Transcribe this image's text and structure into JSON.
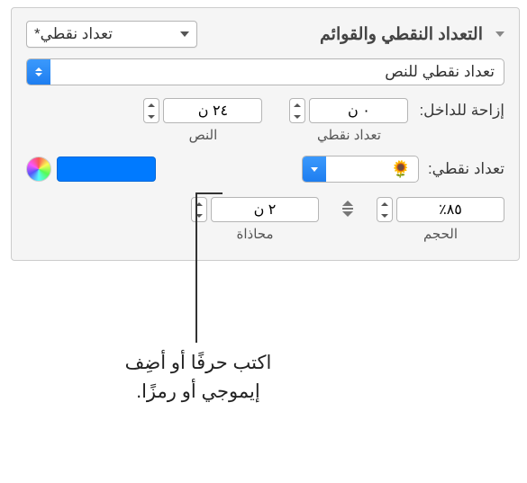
{
  "header": {
    "title": "التعداد النقطي والقوائم",
    "style_popup": "تعداد نقطي*"
  },
  "list_type": {
    "value": "تعداد نقطي للنص"
  },
  "indent": {
    "label": "إزاحة للداخل:",
    "bullet": {
      "value": "٠ ن",
      "caption": "تعداد نقطي"
    },
    "text": {
      "value": "٢٤ ن",
      "caption": "النص"
    }
  },
  "bullet": {
    "label": "تعداد نقطي:",
    "emoji": "🌻",
    "color": "#007aff"
  },
  "size": {
    "value": "٨٥٪",
    "caption": "الحجم"
  },
  "align": {
    "value": "٢ ن",
    "caption": "محاذاة"
  },
  "callout": {
    "text_line1": "اكتب حرفًا أو أضِف",
    "text_line2": "إيموجي أو رمزًا."
  }
}
